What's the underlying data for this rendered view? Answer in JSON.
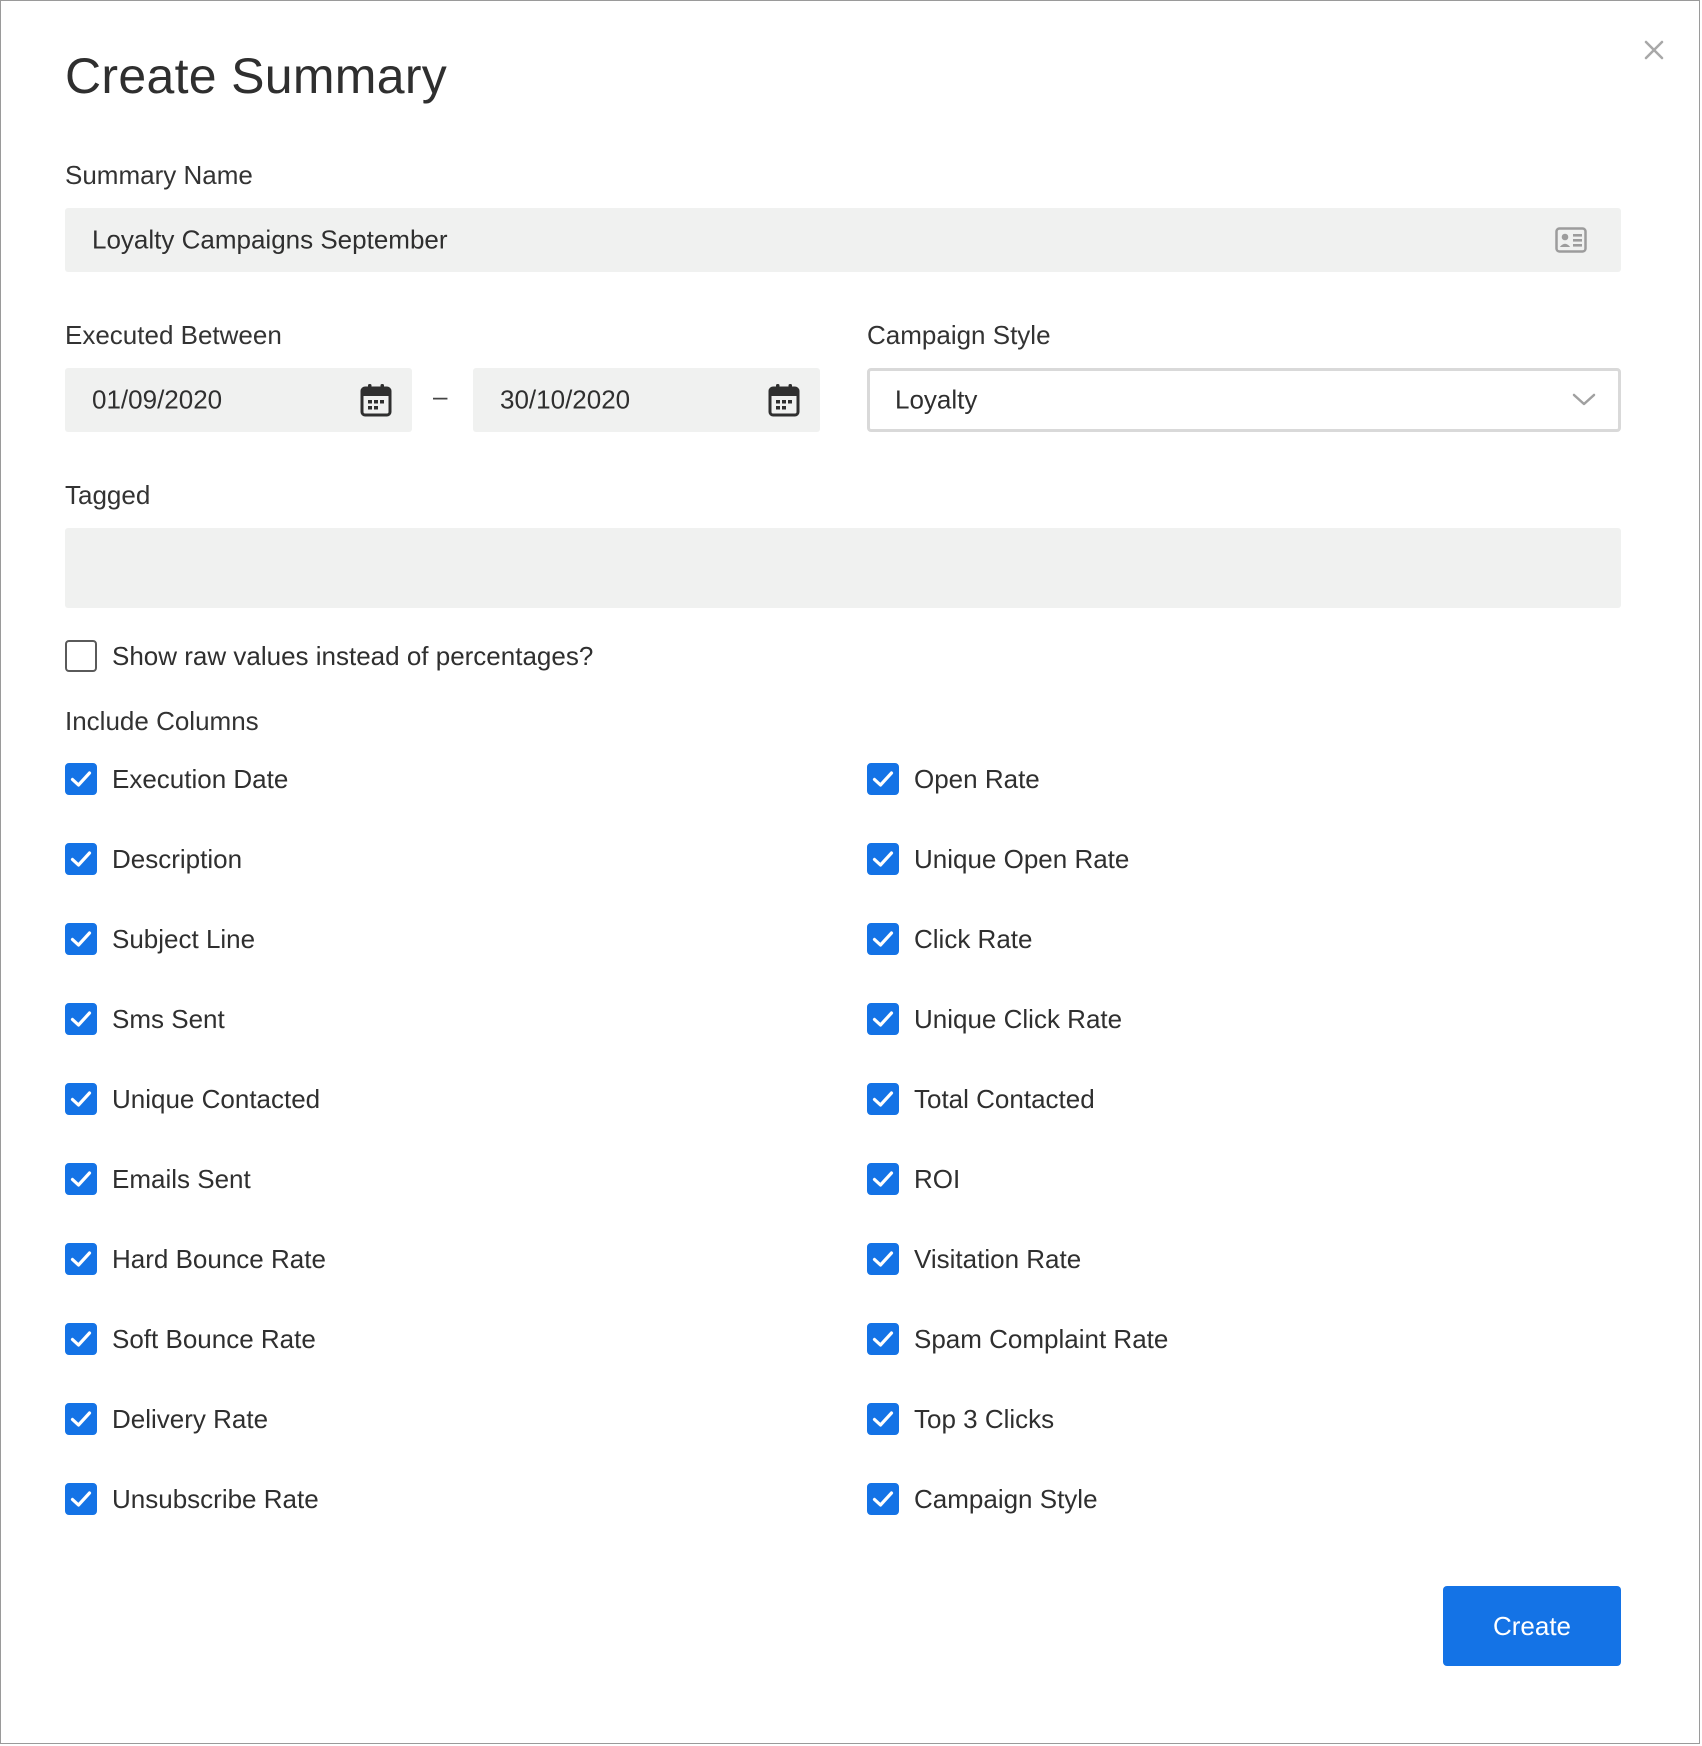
{
  "dialog": {
    "title": "Create Summary",
    "close_icon": "close-icon"
  },
  "summary_name": {
    "label": "Summary Name",
    "value": "Loyalty Campaigns September",
    "icon": "contact-card-icon"
  },
  "executed_between": {
    "label": "Executed Between",
    "start": "01/09/2020",
    "separator": "–",
    "end": "30/10/2020",
    "icon": "calendar-icon"
  },
  "campaign_style": {
    "label": "Campaign Style",
    "selected": "Loyalty",
    "icon": "chevron-down-icon"
  },
  "tagged": {
    "label": "Tagged",
    "value": ""
  },
  "raw_values": {
    "label": "Show raw values instead of percentages?",
    "checked": false
  },
  "include_columns": {
    "label": "Include Columns",
    "left": [
      {
        "label": "Execution Date",
        "checked": true
      },
      {
        "label": "Description",
        "checked": true
      },
      {
        "label": "Subject Line",
        "checked": true
      },
      {
        "label": "Sms Sent",
        "checked": true
      },
      {
        "label": "Unique Contacted",
        "checked": true
      },
      {
        "label": "Emails Sent",
        "checked": true
      },
      {
        "label": "Hard Bounce Rate",
        "checked": true
      },
      {
        "label": "Soft Bounce Rate",
        "checked": true
      },
      {
        "label": "Delivery Rate",
        "checked": true
      },
      {
        "label": "Unsubscribe Rate",
        "checked": true
      }
    ],
    "right": [
      {
        "label": "Open Rate",
        "checked": true
      },
      {
        "label": "Unique Open Rate",
        "checked": true
      },
      {
        "label": "Click Rate",
        "checked": true
      },
      {
        "label": "Unique Click Rate",
        "checked": true
      },
      {
        "label": "Total Contacted",
        "checked": true
      },
      {
        "label": "ROI",
        "checked": true
      },
      {
        "label": "Visitation Rate",
        "checked": true
      },
      {
        "label": "Spam Complaint Rate",
        "checked": true
      },
      {
        "label": "Top 3 Clicks",
        "checked": true
      },
      {
        "label": "Campaign Style",
        "checked": true
      }
    ]
  },
  "actions": {
    "create_label": "Create"
  },
  "colors": {
    "accent": "#1473e6",
    "field_bg": "#f0f1f0",
    "text": "#2f2f2f"
  }
}
